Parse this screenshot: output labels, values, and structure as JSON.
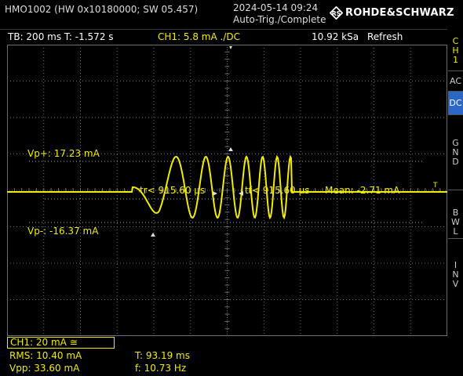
{
  "header": {
    "device": "HMO1002 (HW 0x10180000; SW 05.457)",
    "timestamp": "2024-05-14 09:24",
    "trigger_status": "Auto-Trig./Complete",
    "brand": "ROHDE&SCHWARZ"
  },
  "status_bar": {
    "timebase": "TB: 200 ms  T: -1.572 s",
    "channel_setting": "CH1: 5.8 mA ./DC",
    "sample_rate": "10.92 kSa",
    "mode": "Refresh"
  },
  "screen": {
    "vp_plus_label": "Vp+: 17.23 mA",
    "vp_minus_label": "Vp-: -16.37 mA",
    "rise_label": "tr< 915.60 µs",
    "fall_label": "tf< 915.60 µs",
    "mean_label": "Mean: -2.71 mA",
    "channel_marker": "1",
    "trigger_marker": "T"
  },
  "side_menu": {
    "ch": [
      "C",
      "H",
      "1"
    ],
    "ac": "AC",
    "dc": "DC",
    "gnd": [
      "G",
      "N",
      "D"
    ],
    "bwl": [
      "B",
      "W",
      "L"
    ],
    "inv": [
      "I",
      "N",
      "V"
    ]
  },
  "measurements": {
    "channel_scale": "CH1: 20 mA ≅",
    "rms": "RMS: 10.40 mA",
    "vpp": "Vpp: 33.60 mA",
    "period": "T: 93.19 ms",
    "frequency": "f: 10.73 Hz"
  },
  "colors": {
    "trace": "#f2ec00",
    "grid": "#6e6e6e",
    "dc_active": "#2b67c7"
  }
}
